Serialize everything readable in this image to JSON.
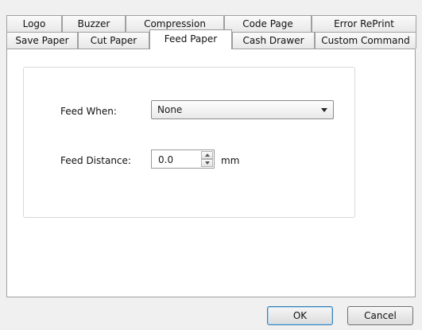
{
  "tabs_back_row": [
    {
      "label": "Logo"
    },
    {
      "label": "Buzzer"
    },
    {
      "label": "Compression"
    },
    {
      "label": "Code Page"
    },
    {
      "label": "Error RePrint"
    }
  ],
  "tabs_front_row": [
    {
      "label": "Save Paper"
    },
    {
      "label": "Cut Paper"
    },
    {
      "label": "Feed Paper",
      "active": true
    },
    {
      "label": "Cash Drawer"
    },
    {
      "label": "Custom Command"
    }
  ],
  "feed_when": {
    "label": "Feed When:",
    "value": "None"
  },
  "feed_distance": {
    "label": "Feed Distance:",
    "value": "0.0",
    "unit": "mm"
  },
  "buttons": {
    "ok": "OK",
    "cancel": "Cancel"
  }
}
